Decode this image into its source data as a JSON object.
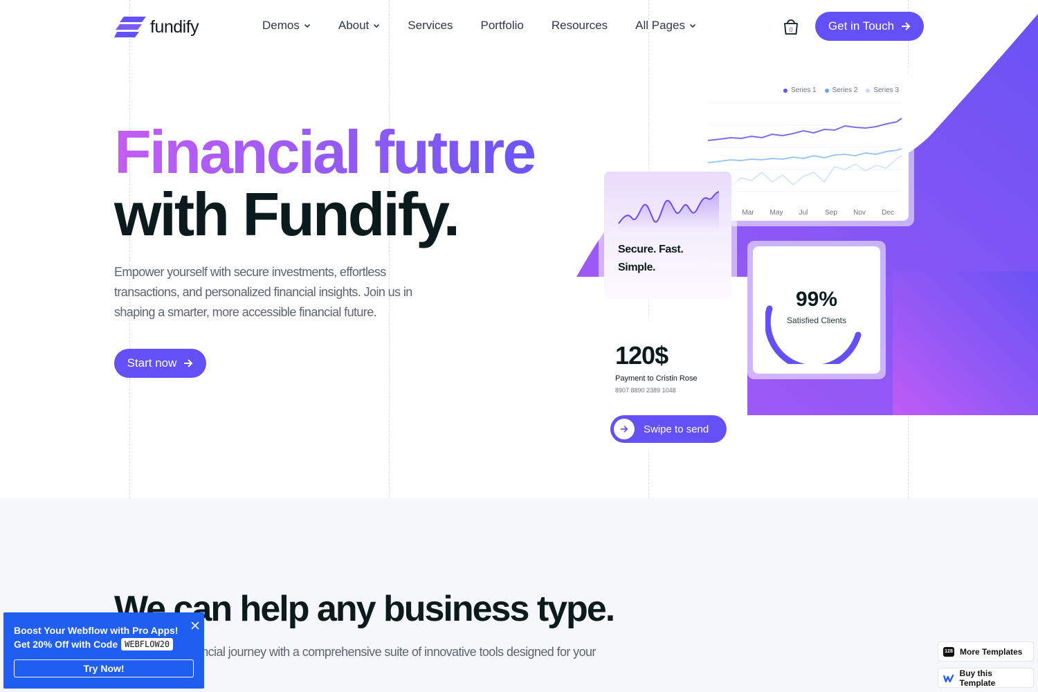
{
  "nav": {
    "logo_text": "fundify",
    "menu": [
      {
        "label": "Demos",
        "dropdown": true
      },
      {
        "label": "About",
        "dropdown": true
      },
      {
        "label": "Services",
        "dropdown": false
      },
      {
        "label": "Portfolio",
        "dropdown": false
      },
      {
        "label": "Resources",
        "dropdown": false
      },
      {
        "label": "All Pages",
        "dropdown": true
      }
    ],
    "cart_count": "0",
    "cta_label": "Get in Touch"
  },
  "hero": {
    "title_line1": "Financial future",
    "title_line2": "with Fundify.",
    "description": "Empower yourself with secure investments, effortless transactions, and personalized financial insights. Join us in shaping a smarter, more accessible financial future.",
    "start_label": "Start now"
  },
  "cards": {
    "line_chart": {
      "legend": [
        "Series 1",
        "Series 2",
        "Series 3"
      ],
      "months": [
        "Mar",
        "May",
        "Jul",
        "Sep",
        "Nov",
        "Dec"
      ]
    },
    "secure": {
      "line1": "Secure. Fast.",
      "line2": "Simple."
    },
    "satisfaction": {
      "value": "99%",
      "label": "Satisfied Clients",
      "fraction": 0.99
    },
    "payment": {
      "amount": "120$",
      "recipient": "Payment to Cristin Rose",
      "card_number": "8907 8890 2389 1048",
      "swipe_label": "Swipe to send"
    }
  },
  "section2": {
    "title": "We can help any business type.",
    "description": "Simplify your financial journey with a comprehensive suite of innovative tools designed for your needs"
  },
  "promo": {
    "line1": "Boost Your Webflow with Pro Apps!",
    "line2": "Get 20% Off with Code",
    "code": "WEBFLOW20",
    "button": "Try Now!"
  },
  "side_buttons": {
    "more_badge": "128",
    "more_label": "More Templates",
    "buy_label": "Buy this Template"
  },
  "colors": {
    "accent": "#6350f6",
    "purple_light": "#b15cf5",
    "promo_blue": "#1f5ef0"
  }
}
